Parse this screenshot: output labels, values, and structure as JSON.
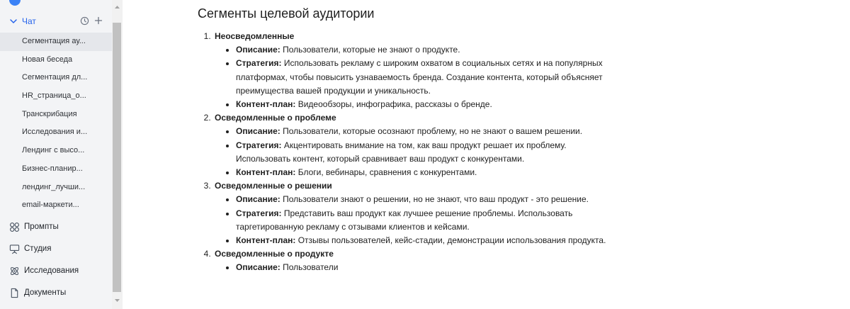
{
  "sidebar": {
    "chat_label": "Чат",
    "chats": [
      "Сегментация ау...",
      "Новая беседа",
      "Сегментация дл...",
      "HR_страница_о...",
      "Транскрибация",
      "Исследования и...",
      "Лендинг с высо...",
      "Бизнес-планир...",
      "лендинг_лучши...",
      "email-маркети..."
    ],
    "nav": {
      "prompts": "Промпты",
      "studio": "Студия",
      "research": "Исследования",
      "documents": "Документы"
    }
  },
  "main": {
    "title": "Сегменты целевой аудитории",
    "segments": [
      {
        "name": "Неосведомленные",
        "items": [
          {
            "label": "Описание:",
            "text": " Пользователи, которые не знают о продукте."
          },
          {
            "label": "Стратегия:",
            "text": " Использовать рекламу с широким охватом в социальных сетях и на популярных платформах, чтобы повысить узнаваемость бренда. Создание контента, который объясняет преимущества вашей продукции и уникальность."
          },
          {
            "label": "Контент-план:",
            "text": " Видеообзоры, инфографика, рассказы о бренде."
          }
        ]
      },
      {
        "name": "Осведомленные о проблеме",
        "items": [
          {
            "label": "Описание:",
            "text": " Пользователи, которые осознают проблему, но не знают о вашем решении."
          },
          {
            "label": "Стратегия:",
            "text": " Акцентировать внимание на том, как ваш продукт решает их проблему. Использовать контент, который сравнивает ваш продукт с конкурентами."
          },
          {
            "label": "Контент-план:",
            "text": " Блоги, вебинары, сравнения с конкурентами."
          }
        ]
      },
      {
        "name": "Осведомленные о решении",
        "items": [
          {
            "label": "Описание:",
            "text": " Пользователи знают о решении, но не знают, что ваш продукт - это решение."
          },
          {
            "label": "Стратегия:",
            "text": " Представить ваш продукт как лучшее решение проблемы. Использовать таргетированную рекламу с отзывами клиентов и кейсами."
          },
          {
            "label": "Контент-план:",
            "text": " Отзывы пользователей, кейс-стадии, демонстрации использования продукта."
          }
        ]
      },
      {
        "name": "Осведомленные о продукте",
        "items": [
          {
            "label": "Описание:",
            "text": " Пользователи"
          }
        ]
      }
    ]
  },
  "colors": {
    "accent": "#2563eb",
    "sidebar_bg": "#f3f4f6",
    "active_item_bg": "#e5e7eb"
  },
  "icons": {
    "chat_toggle": "chevron-down-icon",
    "history": "clock-icon",
    "new_chat": "plus-icon",
    "prompts": "grid-icon",
    "studio": "easel-icon",
    "research": "atom-icon",
    "documents": "document-icon"
  }
}
